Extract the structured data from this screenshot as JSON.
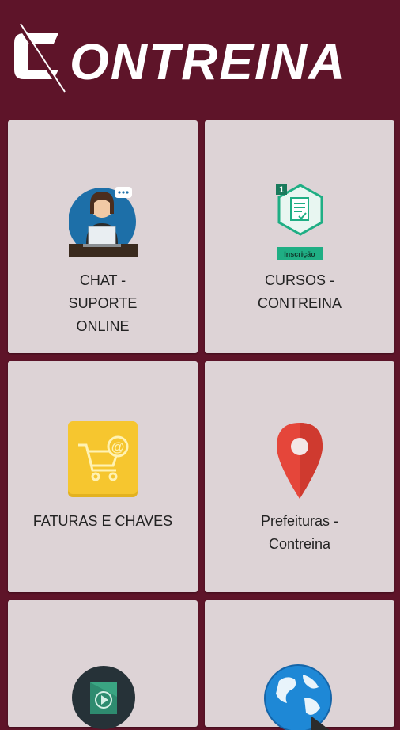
{
  "app": {
    "title": "CONTREINA"
  },
  "menu": {
    "items": [
      {
        "label": "CHAT - SUPORTE ONLINE",
        "icon": "support-agent-icon"
      },
      {
        "label": "CURSOS - CONTREINA",
        "icon": "course-certificate-icon",
        "badge_number": "1",
        "badge_text": "Inscrição"
      },
      {
        "label": "FATURAS E CHAVES",
        "icon": "shopping-cart-email-icon"
      },
      {
        "label": "Prefeituras - Contreina",
        "icon": "map-pin-icon"
      },
      {
        "label": "",
        "icon": "video-play-icon"
      },
      {
        "label": "",
        "icon": "globe-icon"
      }
    ]
  },
  "colors": {
    "background": "#5e1429",
    "card": "#ddd3d6",
    "text": "#222222",
    "accent_green": "#1fae84",
    "pin_red": "#e5463a",
    "cart_yellow": "#f6c62f"
  }
}
